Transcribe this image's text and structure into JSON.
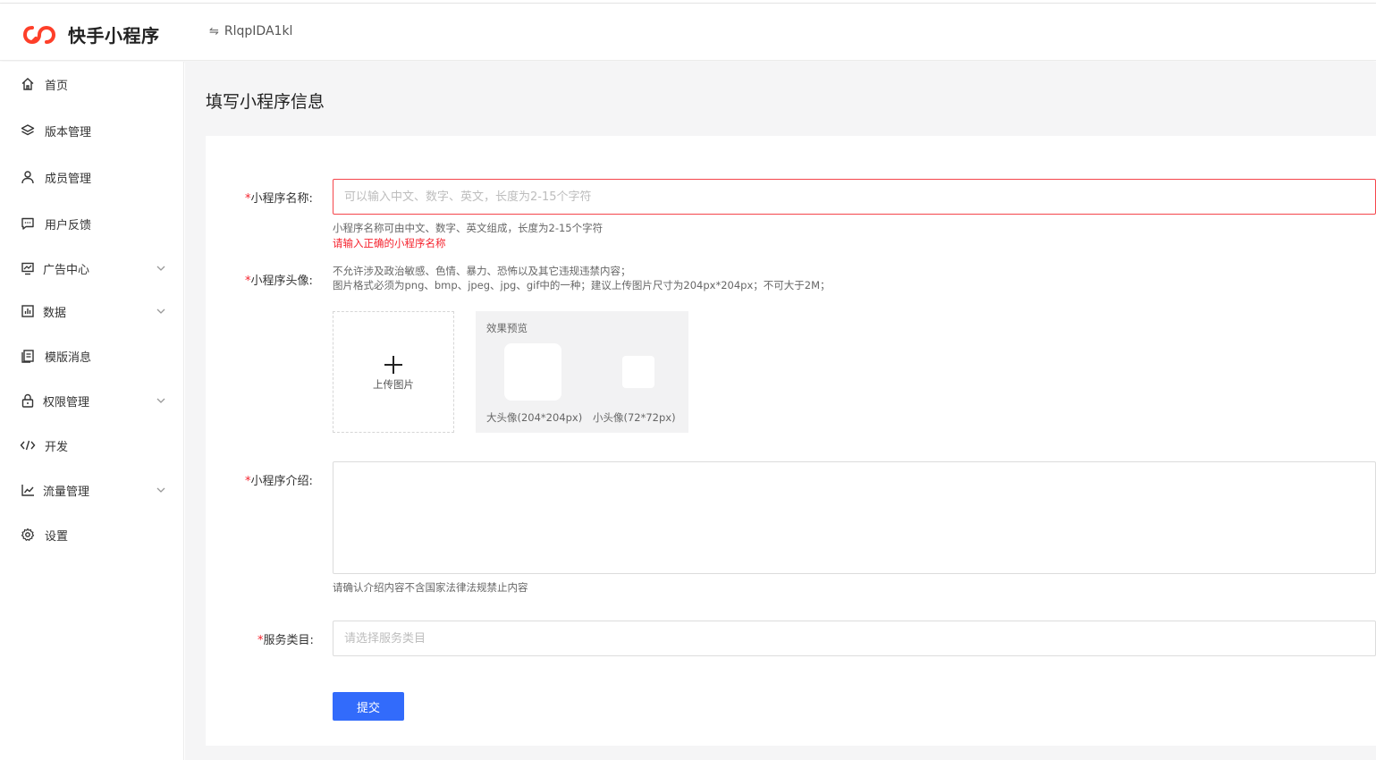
{
  "header": {
    "app_name": "快手小程序",
    "app_id": "RlqpIDA1kl",
    "brand_color": "#fe3f29"
  },
  "sidebar": {
    "items": [
      {
        "label": "首页",
        "icon": "home-icon",
        "has_submenu": false
      },
      {
        "label": "版本管理",
        "icon": "layers-icon",
        "has_submenu": false
      },
      {
        "label": "成员管理",
        "icon": "user-icon",
        "has_submenu": false
      },
      {
        "label": "用户反馈",
        "icon": "message-icon",
        "has_submenu": false
      },
      {
        "label": "广告中心",
        "icon": "ad-chart-icon",
        "has_submenu": true
      },
      {
        "label": "数据",
        "icon": "bar-chart-icon",
        "has_submenu": true
      },
      {
        "label": "模版消息",
        "icon": "document-icon",
        "has_submenu": false
      },
      {
        "label": "权限管理",
        "icon": "lock-icon",
        "has_submenu": true
      },
      {
        "label": "开发",
        "icon": "code-icon",
        "has_submenu": false
      },
      {
        "label": "流量管理",
        "icon": "line-chart-icon",
        "has_submenu": true
      },
      {
        "label": "设置",
        "icon": "gear-icon",
        "has_submenu": false
      }
    ]
  },
  "main": {
    "page_title": "填写小程序信息",
    "form": {
      "required_mark": "*",
      "name": {
        "label": "小程序名称:",
        "placeholder": "可以输入中文、数字、英文，长度为2-15个字符",
        "value": "",
        "hint": "小程序名称可由中文、数字、英文组成，长度为2-15个字符",
        "error": "请输入正确的小程序名称"
      },
      "avatar": {
        "label": "小程序头像:",
        "rule1": "不允许涉及政治敏感、色情、暴力、恐怖以及其它违规违禁内容；",
        "rule2": "图片格式必须为png、bmp、jpeg、jpg、gif中的一种；建议上传图片尺寸为204px*204px；不可大于2M；",
        "upload_label": "上传图片",
        "preview_title": "效果预览",
        "big_label": "大头像(204*204px)",
        "small_label": "小头像(72*72px)"
      },
      "intro": {
        "label": "小程序介绍:",
        "value": "",
        "hint": "请确认介绍内容不含国家法律法规禁止内容"
      },
      "category": {
        "label": "服务类目:",
        "placeholder": "请选择服务类目",
        "value": ""
      },
      "submit_label": "提交"
    }
  }
}
